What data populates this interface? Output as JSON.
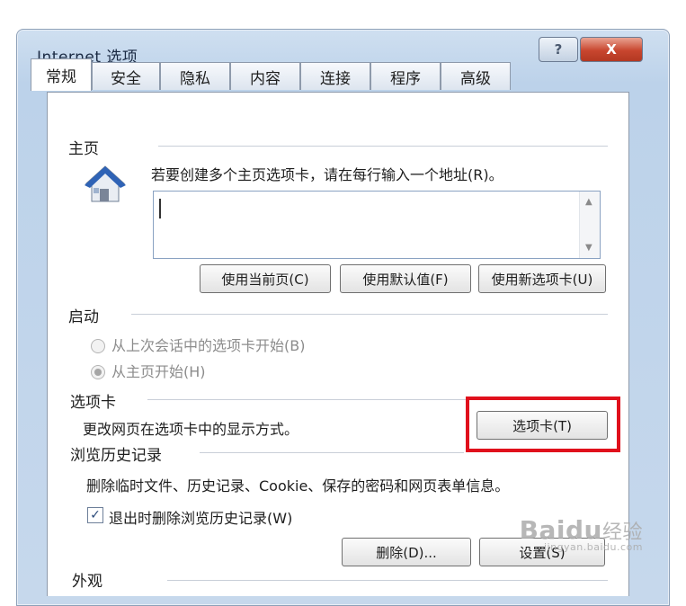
{
  "window": {
    "title": "Internet 选项",
    "help_label": "?",
    "close_label": "X"
  },
  "tabs": [
    {
      "label": "常规",
      "active": true
    },
    {
      "label": "安全"
    },
    {
      "label": "隐私"
    },
    {
      "label": "内容"
    },
    {
      "label": "连接"
    },
    {
      "label": "程序"
    },
    {
      "label": "高级"
    }
  ],
  "homepage": {
    "group_label": "主页",
    "instruction": "若要创建多个主页选项卡，请在每行输入一个地址(R)。",
    "address_value": "",
    "use_current_label": "使用当前页(C)",
    "use_default_label": "使用默认值(F)",
    "use_new_tab_label": "使用新选项卡(U)"
  },
  "startup": {
    "group_label": "启动",
    "option_last_session": "从上次会话中的选项卡开始(B)",
    "option_homepage": "从主页开始(H)",
    "selected": "option_homepage"
  },
  "tabs_section": {
    "group_label": "选项卡",
    "description": "更改网页在选项卡中的显示方式。",
    "button_label": "选项卡(T)"
  },
  "history": {
    "group_label": "浏览历史记录",
    "description": "删除临时文件、历史记录、Cookie、保存的密码和网页表单信息。",
    "delete_on_exit_label": "退出时删除浏览历史记录(W)",
    "delete_on_exit_checked": true,
    "delete_label": "删除(D)...",
    "settings_label": "设置(S)"
  },
  "appearance": {
    "group_label": "外观"
  },
  "watermark": {
    "brand": "Baidu",
    "brand_cn": "经验",
    "url": "jingyan.baidu.com"
  },
  "colors": {
    "highlight": "#e0101c",
    "title_bar": "#c6d8ec",
    "close_button": "#c8462e"
  }
}
